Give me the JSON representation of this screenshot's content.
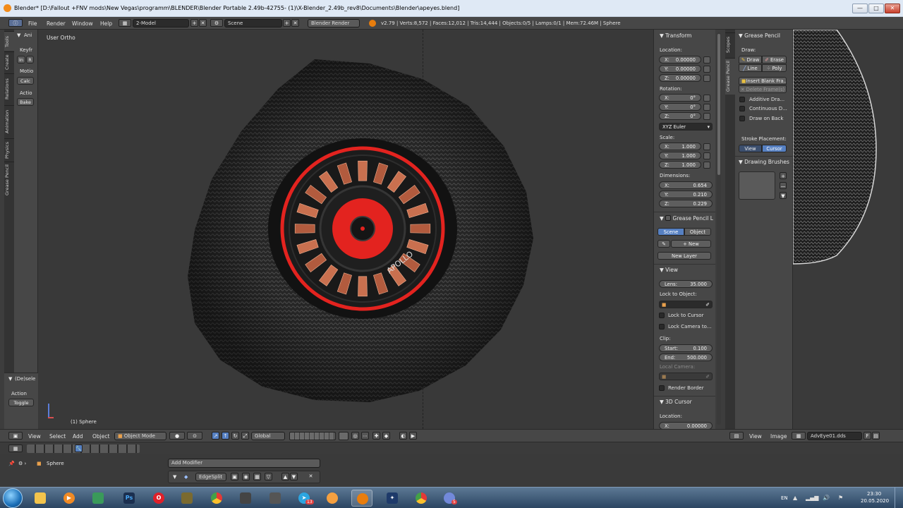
{
  "window": {
    "title": "Blender* [D:\\Fallout +FNV mods\\New Vegas\\programm\\BLENDER\\Blender Portable 2.49b-42755- (1)\\X-Blender_2.49b_rev8\\Documents\\Blender\\apeyes.blend]",
    "min_label": "—",
    "max_label": "□",
    "close_label": "✕"
  },
  "infobar": {
    "editor_icon": "info-icon",
    "menus": [
      "File",
      "Render",
      "Window",
      "Help"
    ],
    "layout": "2-Model",
    "scene": "Scene",
    "engine": "Blender Render",
    "stats": "v2.79 | Verts:8,572 | Faces:12,012 | Tris:14,444 | Objects:0/5 | Lamps:0/1 | Mem:72.46M | Sphere",
    "add_glyph": "+",
    "remove_glyph": "✕"
  },
  "left_tabs": [
    "Tools",
    "Create",
    "Relations",
    "Animation",
    "Physics",
    "Grease Pencil"
  ],
  "left_panel": {
    "header": "Ani",
    "keyframes_label": "Keyfr",
    "insert": "In",
    "remove": "R",
    "motion_label": "Motio",
    "calc": "Calc",
    "action_label": "Actio",
    "bake": "Bake"
  },
  "operator": {
    "title": "(De)sele",
    "action_label": "Action",
    "action_value": "Toggle"
  },
  "viewport": {
    "view_label": "User Ortho",
    "object_label": "(1) Sphere",
    "brand_text": "APOLLO"
  },
  "n_panel": {
    "transform": "Transform",
    "location_label": "Location:",
    "location": [
      {
        "k": "X:",
        "v": "0.00000"
      },
      {
        "k": "Y:",
        "v": "0.00000"
      },
      {
        "k": "Z:",
        "v": "0.00000"
      }
    ],
    "rotation_label": "Rotation:",
    "rotation": [
      {
        "k": "X:",
        "v": "0°"
      },
      {
        "k": "Y:",
        "v": "0°"
      },
      {
        "k": "Z:",
        "v": "0°"
      }
    ],
    "rotation_mode": "XYZ Euler",
    "scale_label": "Scale:",
    "scale": [
      {
        "k": "X:",
        "v": "1.000"
      },
      {
        "k": "Y:",
        "v": "1.000"
      },
      {
        "k": "Z:",
        "v": "1.000"
      }
    ],
    "dimensions_label": "Dimensions:",
    "dimensions": [
      {
        "k": "X:",
        "v": "0.654"
      },
      {
        "k": "Y:",
        "v": "0.210"
      },
      {
        "k": "Z:",
        "v": "0.229"
      }
    ],
    "gp_layers": "Grease Pencil L",
    "scene_tab": "Scene",
    "object_tab": "Object",
    "new": "New",
    "new_layer": "New Layer",
    "view": "View",
    "lens": {
      "k": "Lens:",
      "v": "35.000"
    },
    "lock_to_object": "Lock to Object:",
    "lock_to_cursor": "Lock to Cursor",
    "lock_camera": "Lock Camera to...",
    "clip_label": "Clip:",
    "clip_start": {
      "k": "Start:",
      "v": "0.100"
    },
    "clip_end": {
      "k": "End:",
      "v": "500.000"
    },
    "local_camera": "Local Camera:",
    "render_border": "Render Border",
    "cursor_3d": "3D Cursor",
    "cursor_location_label": "Location:",
    "cursor_x": {
      "k": "X:",
      "v": "0.00000"
    }
  },
  "gp_panel": {
    "tabs": [
      "Scopes",
      "Grease Pencil"
    ],
    "header": "Grease Pencil",
    "draw_label": "Draw:",
    "draw": "Draw",
    "erase": "Erase",
    "line": "Line",
    "poly": "Poly",
    "insert_blank": "Insert Blank Fra...",
    "delete_frames": "Delete Frame(s)",
    "additive": "Additive Dra...",
    "continuous": "Continuous D...",
    "draw_on_back": "Draw on Back",
    "stroke_placement": "Stroke Placement:",
    "view": "View",
    "cursor": "Cursor",
    "drawing_brushes": "Drawing Brushes",
    "plus": "+",
    "minus": "—",
    "down": "▼"
  },
  "v3d_header": {
    "menus": [
      "View",
      "Select",
      "Add",
      "Object"
    ],
    "mode": "Object Mode",
    "orientation": "Global"
  },
  "img_header": {
    "menus": [
      "View",
      "Image"
    ],
    "image_name": "AdvEye01.dds",
    "fake_user": "F"
  },
  "properties": {
    "object_name": "Sphere",
    "add_modifier": "Add Modifier",
    "modifier_name": "EdgeSplit"
  },
  "taskbar": {
    "lang": "EN",
    "time": "23:30",
    "date": "20.05.2020",
    "ps_label": "Ps",
    "badge_13": "13",
    "badge_5": "5"
  },
  "colors": {
    "accent_red": "#e3231f",
    "blender_blue": "#5680c2",
    "panel_gray": "#474747",
    "viewport_gray": "#393939"
  }
}
